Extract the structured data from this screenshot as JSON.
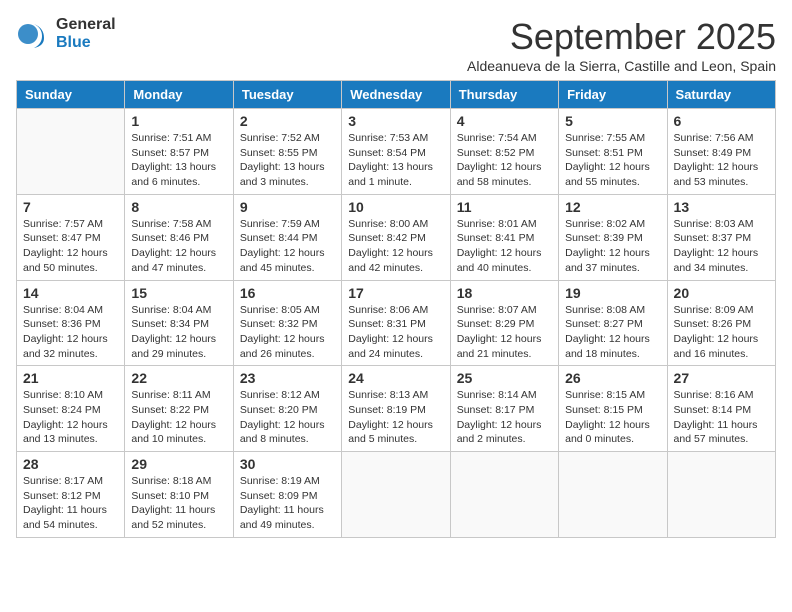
{
  "logo": {
    "general": "General",
    "blue": "Blue"
  },
  "title": "September 2025",
  "subtitle": "Aldeanueva de la Sierra, Castille and Leon, Spain",
  "weekdays": [
    "Sunday",
    "Monday",
    "Tuesday",
    "Wednesday",
    "Thursday",
    "Friday",
    "Saturday"
  ],
  "weeks": [
    [
      {
        "day": "",
        "text": ""
      },
      {
        "day": "1",
        "text": "Sunrise: 7:51 AM\nSunset: 8:57 PM\nDaylight: 13 hours\nand 6 minutes."
      },
      {
        "day": "2",
        "text": "Sunrise: 7:52 AM\nSunset: 8:55 PM\nDaylight: 13 hours\nand 3 minutes."
      },
      {
        "day": "3",
        "text": "Sunrise: 7:53 AM\nSunset: 8:54 PM\nDaylight: 13 hours\nand 1 minute."
      },
      {
        "day": "4",
        "text": "Sunrise: 7:54 AM\nSunset: 8:52 PM\nDaylight: 12 hours\nand 58 minutes."
      },
      {
        "day": "5",
        "text": "Sunrise: 7:55 AM\nSunset: 8:51 PM\nDaylight: 12 hours\nand 55 minutes."
      },
      {
        "day": "6",
        "text": "Sunrise: 7:56 AM\nSunset: 8:49 PM\nDaylight: 12 hours\nand 53 minutes."
      }
    ],
    [
      {
        "day": "7",
        "text": "Sunrise: 7:57 AM\nSunset: 8:47 PM\nDaylight: 12 hours\nand 50 minutes."
      },
      {
        "day": "8",
        "text": "Sunrise: 7:58 AM\nSunset: 8:46 PM\nDaylight: 12 hours\nand 47 minutes."
      },
      {
        "day": "9",
        "text": "Sunrise: 7:59 AM\nSunset: 8:44 PM\nDaylight: 12 hours\nand 45 minutes."
      },
      {
        "day": "10",
        "text": "Sunrise: 8:00 AM\nSunset: 8:42 PM\nDaylight: 12 hours\nand 42 minutes."
      },
      {
        "day": "11",
        "text": "Sunrise: 8:01 AM\nSunset: 8:41 PM\nDaylight: 12 hours\nand 40 minutes."
      },
      {
        "day": "12",
        "text": "Sunrise: 8:02 AM\nSunset: 8:39 PM\nDaylight: 12 hours\nand 37 minutes."
      },
      {
        "day": "13",
        "text": "Sunrise: 8:03 AM\nSunset: 8:37 PM\nDaylight: 12 hours\nand 34 minutes."
      }
    ],
    [
      {
        "day": "14",
        "text": "Sunrise: 8:04 AM\nSunset: 8:36 PM\nDaylight: 12 hours\nand 32 minutes."
      },
      {
        "day": "15",
        "text": "Sunrise: 8:04 AM\nSunset: 8:34 PM\nDaylight: 12 hours\nand 29 minutes."
      },
      {
        "day": "16",
        "text": "Sunrise: 8:05 AM\nSunset: 8:32 PM\nDaylight: 12 hours\nand 26 minutes."
      },
      {
        "day": "17",
        "text": "Sunrise: 8:06 AM\nSunset: 8:31 PM\nDaylight: 12 hours\nand 24 minutes."
      },
      {
        "day": "18",
        "text": "Sunrise: 8:07 AM\nSunset: 8:29 PM\nDaylight: 12 hours\nand 21 minutes."
      },
      {
        "day": "19",
        "text": "Sunrise: 8:08 AM\nSunset: 8:27 PM\nDaylight: 12 hours\nand 18 minutes."
      },
      {
        "day": "20",
        "text": "Sunrise: 8:09 AM\nSunset: 8:26 PM\nDaylight: 12 hours\nand 16 minutes."
      }
    ],
    [
      {
        "day": "21",
        "text": "Sunrise: 8:10 AM\nSunset: 8:24 PM\nDaylight: 12 hours\nand 13 minutes."
      },
      {
        "day": "22",
        "text": "Sunrise: 8:11 AM\nSunset: 8:22 PM\nDaylight: 12 hours\nand 10 minutes."
      },
      {
        "day": "23",
        "text": "Sunrise: 8:12 AM\nSunset: 8:20 PM\nDaylight: 12 hours\nand 8 minutes."
      },
      {
        "day": "24",
        "text": "Sunrise: 8:13 AM\nSunset: 8:19 PM\nDaylight: 12 hours\nand 5 minutes."
      },
      {
        "day": "25",
        "text": "Sunrise: 8:14 AM\nSunset: 8:17 PM\nDaylight: 12 hours\nand 2 minutes."
      },
      {
        "day": "26",
        "text": "Sunrise: 8:15 AM\nSunset: 8:15 PM\nDaylight: 12 hours\nand 0 minutes."
      },
      {
        "day": "27",
        "text": "Sunrise: 8:16 AM\nSunset: 8:14 PM\nDaylight: 11 hours\nand 57 minutes."
      }
    ],
    [
      {
        "day": "28",
        "text": "Sunrise: 8:17 AM\nSunset: 8:12 PM\nDaylight: 11 hours\nand 54 minutes."
      },
      {
        "day": "29",
        "text": "Sunrise: 8:18 AM\nSunset: 8:10 PM\nDaylight: 11 hours\nand 52 minutes."
      },
      {
        "day": "30",
        "text": "Sunrise: 8:19 AM\nSunset: 8:09 PM\nDaylight: 11 hours\nand 49 minutes."
      },
      {
        "day": "",
        "text": ""
      },
      {
        "day": "",
        "text": ""
      },
      {
        "day": "",
        "text": ""
      },
      {
        "day": "",
        "text": ""
      }
    ]
  ]
}
